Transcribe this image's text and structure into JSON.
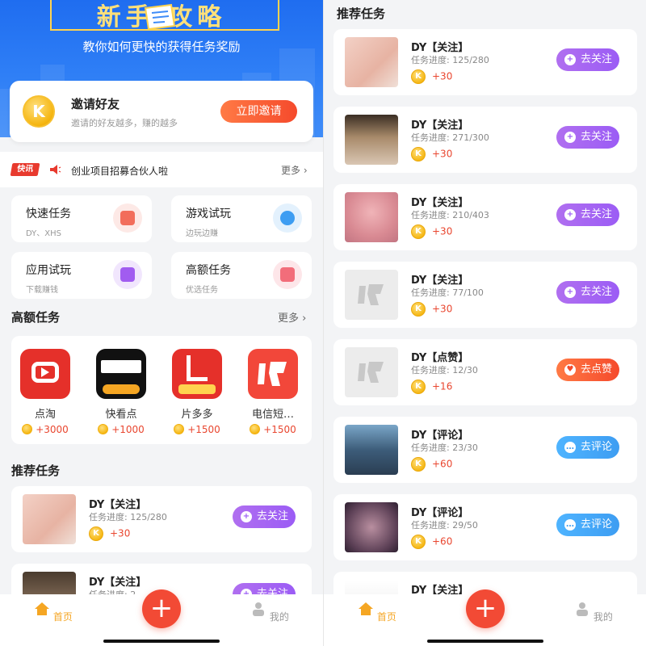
{
  "left": {
    "banner": {
      "title": "新手 攻略",
      "subtitle": "教你如何更快的获得任务奖励"
    },
    "invite": {
      "title": "邀请好友",
      "desc": "邀请的好友越多，赚的越多",
      "button": "立即邀请",
      "coin_letter": "K"
    },
    "news": {
      "tag": "快讯",
      "text": "创业项目招募合伙人啦",
      "more": "更多 ›"
    },
    "quick_grid": [
      {
        "title": "快速任务",
        "sub": "DY、XHS",
        "icon": "doc-icon",
        "color": "#f26d5b",
        "bg": "#fde9e6"
      },
      {
        "title": "游戏试玩",
        "sub": "边玩边赚",
        "icon": "gamepad-icon",
        "color": "#3d9df2",
        "bg": "#e3f1fd"
      },
      {
        "title": "应用试玩",
        "sub": "下载赚钱",
        "icon": "bag-icon",
        "color": "#a15cf0",
        "bg": "#f1e6fd"
      },
      {
        "title": "高额任务",
        "sub": "优选任务",
        "icon": "yen-icon",
        "color": "#f26d7a",
        "bg": "#fde6e9"
      }
    ],
    "hot": {
      "title": "高额任务",
      "more": "更多 ›",
      "apps": [
        {
          "name": "点淘",
          "reward": "+3000",
          "icon": "diantao-icon"
        },
        {
          "name": "快看点",
          "reward": "+1000",
          "icon": "kuaikandian-icon"
        },
        {
          "name": "片多多",
          "reward": "+1500",
          "icon": "pianduoduo-icon"
        },
        {
          "name": "电信短…",
          "reward": "+1500",
          "icon": "kuai-app-icon"
        }
      ]
    },
    "recommend_title": "推荐任务",
    "tasks": [
      {
        "title": "DY【关注】",
        "progress": "任务进度: 125/280",
        "reward": "+30",
        "button": "去关注"
      },
      {
        "title": "DY【关注】",
        "progress": "任务进度: 2",
        "reward": "",
        "button": "去关注"
      }
    ]
  },
  "right": {
    "title": "推荐任务",
    "tasks": [
      {
        "title": "DY【关注】",
        "progress": "任务进度: 125/280",
        "reward": "+30",
        "button": "去关注",
        "style": "purple",
        "thumb": "photo-pink"
      },
      {
        "title": "DY【关注】",
        "progress": "任务进度: 271/300",
        "reward": "+30",
        "button": "去关注",
        "style": "purple",
        "thumb": "photo-cap"
      },
      {
        "title": "DY【关注】",
        "progress": "任务进度: 210/403",
        "reward": "+30",
        "button": "去关注",
        "style": "purple",
        "thumb": "photo-stage"
      },
      {
        "title": "DY【关注】",
        "progress": "任务进度: 77/100",
        "reward": "+30",
        "button": "去关注",
        "style": "purple",
        "thumb": "placeholder-kuai"
      },
      {
        "title": "DY【点赞】",
        "progress": "任务进度: 12/30",
        "reward": "+16",
        "button": "去点赞",
        "style": "orange",
        "thumb": "placeholder-kuai"
      },
      {
        "title": "DY【评论】",
        "progress": "任务进度: 23/30",
        "reward": "+60",
        "button": "去评论",
        "style": "blue",
        "thumb": "photo-dance"
      },
      {
        "title": "DY【评论】",
        "progress": "任务进度: 29/50",
        "reward": "+60",
        "button": "去评论",
        "style": "blue",
        "thumb": "photo-blur"
      },
      {
        "title": "DY【关注】",
        "progress": "",
        "reward": "",
        "button": "",
        "style": "purple",
        "thumb": "photo-text"
      }
    ]
  },
  "tabbar": {
    "home": "首页",
    "mine": "我的",
    "plus": "+"
  },
  "colors": {
    "accent": "#f24a35",
    "tab_active": "#f5a623",
    "tab_inactive": "#999999"
  }
}
